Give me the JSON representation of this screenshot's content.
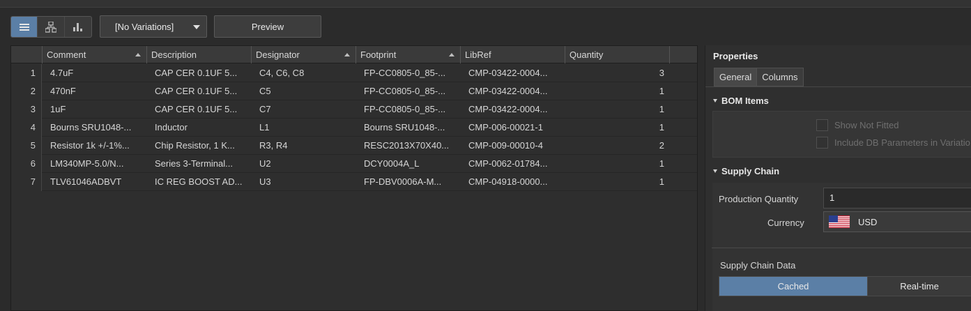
{
  "toolbar": {
    "view_buttons": [
      {
        "icon": "flat-list-icon",
        "active": true
      },
      {
        "icon": "hierarchy-icon",
        "active": false
      },
      {
        "icon": "bar-chart-icon",
        "active": false
      }
    ],
    "variations_value": "[No Variations]",
    "preview_label": "Preview"
  },
  "grid": {
    "columns": [
      {
        "label": "Comment",
        "sorted": true
      },
      {
        "label": "Description",
        "sorted": false
      },
      {
        "label": "Designator",
        "sorted": true
      },
      {
        "label": "Footprint",
        "sorted": true
      },
      {
        "label": "LibRef",
        "sorted": false
      },
      {
        "label": "Quantity",
        "sorted": false
      }
    ],
    "rows": [
      {
        "num": "1",
        "comment": "4.7uF",
        "description": "CAP CER 0.1UF 5...",
        "designator": "C4, C6, C8",
        "footprint": "FP-CC0805-0_85-...",
        "libref": "CMP-03422-0004...",
        "quantity": "3"
      },
      {
        "num": "2",
        "comment": "470nF",
        "description": "CAP CER 0.1UF 5...",
        "designator": "C5",
        "footprint": "FP-CC0805-0_85-...",
        "libref": "CMP-03422-0004...",
        "quantity": "1"
      },
      {
        "num": "3",
        "comment": "1uF",
        "description": "CAP CER 0.1UF 5...",
        "designator": "C7",
        "footprint": "FP-CC0805-0_85-...",
        "libref": "CMP-03422-0004...",
        "quantity": "1"
      },
      {
        "num": "4",
        "comment": "Bourns SRU1048-...",
        "description": "Inductor",
        "designator": "L1",
        "footprint": "Bourns SRU1048-...",
        "libref": "CMP-006-00021-1",
        "quantity": "1"
      },
      {
        "num": "5",
        "comment": "Resistor 1k +/-1%...",
        "description": "Chip Resistor, 1 K...",
        "designator": "R3, R4",
        "footprint": "RESC2013X70X40...",
        "libref": "CMP-009-00010-4",
        "quantity": "2"
      },
      {
        "num": "6",
        "comment": "LM340MP-5.0/N...",
        "description": "Series 3-Terminal...",
        "designator": "U2",
        "footprint": "DCY0004A_L",
        "libref": "CMP-0062-01784...",
        "quantity": "1"
      },
      {
        "num": "7",
        "comment": "TLV61046ADBVT",
        "description": "IC REG BOOST AD...",
        "designator": "U3",
        "footprint": "FP-DBV0006A-M...",
        "libref": "CMP-04918-0000...",
        "quantity": "1"
      }
    ]
  },
  "properties": {
    "title": "Properties",
    "tabs": [
      "General",
      "Columns"
    ],
    "bom_items": {
      "title": "BOM Items",
      "show_not_fitted": "Show Not Fitted",
      "include_db": "Include DB Parameters in Variatio"
    },
    "supply_chain": {
      "title": "Supply Chain",
      "production_quantity_label": "Production Quantity",
      "production_quantity_value": "1",
      "currency_label": "Currency",
      "currency_value": "USD",
      "data_label": "Supply Chain Data",
      "cached_label": "Cached",
      "realtime_label": "Real-time"
    }
  },
  "colors": {
    "accent": "#5b7fa6",
    "background": "#2b2b2b"
  }
}
